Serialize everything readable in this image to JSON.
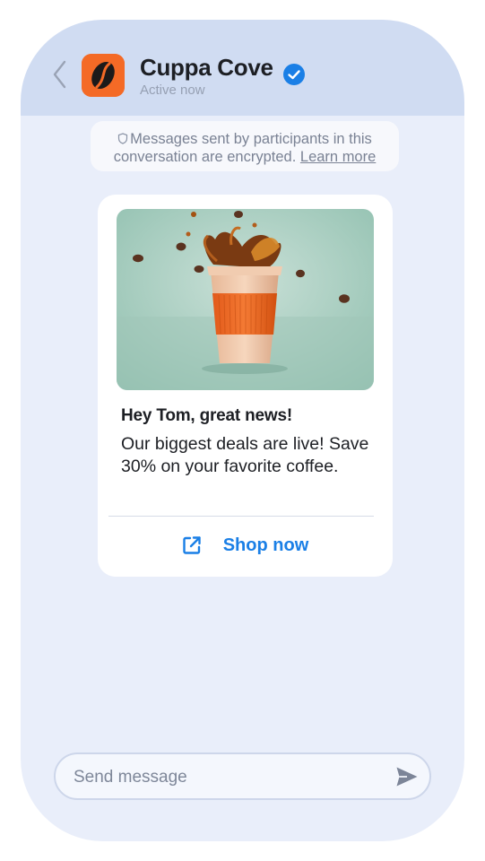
{
  "header": {
    "title": "Cuppa Cove",
    "status": "Active now",
    "back_icon": "chevron-left-icon",
    "logo_icon": "coffee-bean-icon",
    "verified_icon": "verified-check-icon"
  },
  "notice": {
    "text": "Messages sent by participants in this conversation are encrypted.",
    "link": "Learn more",
    "icon": "shield-icon"
  },
  "message": {
    "image": "coffee-cup-splash-image",
    "title": "Hey Tom, great news!",
    "body": "Our biggest deals are live! Save 30% on your favorite coffee.",
    "action_label": "Shop now",
    "action_icon": "external-link-icon"
  },
  "composer": {
    "placeholder": "Send message",
    "send_icon": "send-icon"
  },
  "colors": {
    "header_bg": "#d0dcf2",
    "screen_bg": "#e9eefa",
    "brand_orange": "#f46a26",
    "link_blue": "#1a7fe6",
    "verified_blue": "#1a7fe6"
  }
}
